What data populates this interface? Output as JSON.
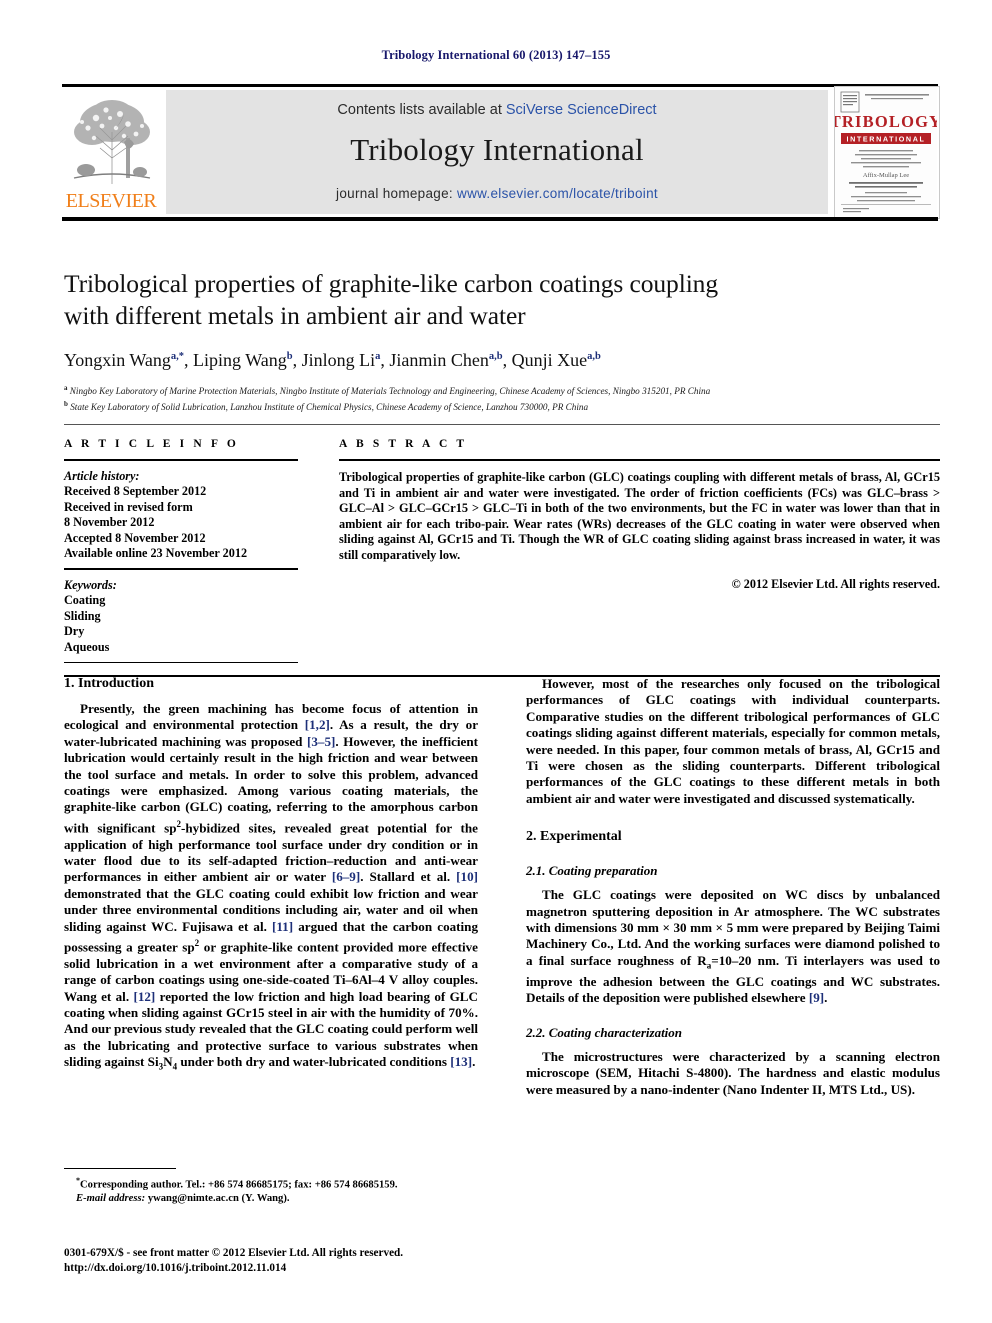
{
  "running_head": "Tribology International 60 (2013) 147–155",
  "masthead": {
    "contents_prefix": "Contents lists available at ",
    "contents_link": "SciVerse ScienceDirect",
    "journal_title": "Tribology International",
    "homepage_prefix": "journal homepage: ",
    "homepage_url": "www.elsevier.com/locate/triboint",
    "publisher_wordmark": "ELSEVIER",
    "cover_title_main": "TRIBOLOGY",
    "cover_title_sub": "INTERNATIONAL"
  },
  "article": {
    "title_line1": "Tribological properties of graphite-like carbon coatings coupling",
    "title_line2": "with different metals in ambient air and water",
    "authors": [
      {
        "name": "Yongxin Wang",
        "sup": "a,*"
      },
      {
        "name": "Liping Wang",
        "sup": "b"
      },
      {
        "name": "Jinlong Li",
        "sup": "a"
      },
      {
        "name": "Jianmin Chen",
        "sup": "a,b"
      },
      {
        "name": "Qunji Xue",
        "sup": "a,b"
      }
    ],
    "affiliations": [
      {
        "marker": "a",
        "text": "Ningbo Key Laboratory of Marine Protection Materials, Ningbo Institute of Materials Technology and Engineering, Chinese Academy of Sciences, Ningbo 315201, PR China"
      },
      {
        "marker": "b",
        "text": "State Key Laboratory of Solid Lubrication, Lanzhou Institute of Chemical Physics, Chinese Academy of Science, Lanzhou 730000, PR China"
      }
    ]
  },
  "article_info": {
    "label": "A R T I C L E   I N F O",
    "history_label": "Article history:",
    "history": [
      "Received 8 September 2012",
      "Received in revised form",
      "8 November 2012",
      "Accepted 8 November 2012",
      "Available online 23 November 2012"
    ],
    "keywords_label": "Keywords:",
    "keywords": [
      "Coating",
      "Sliding",
      "Dry",
      "Aqueous"
    ]
  },
  "abstract": {
    "label": "A B S T R A C T",
    "text": "Tribological properties of graphite-like carbon (GLC) coatings coupling with different metals of brass, Al, GCr15 and Ti in ambient air and water were investigated. The order of friction coefficients (FCs) was GLC–brass > GLC–Al > GLC–GCr15 > GLC–Ti in both of the two environments, but the FC in water was lower than that in ambient air for each tribo-pair. Wear rates (WRs) decreases of the GLC coating in water were observed when sliding against Al, GCr15 and Ti. Though the WR of GLC coating sliding against brass increased in water, it was still comparatively low.",
    "copyright": "© 2012 Elsevier Ltd. All rights reserved."
  },
  "sections": {
    "introduction_heading": "1.  Introduction",
    "intro_p1_a": "Presently, the green machining has become focus of attention in ecological and environmental protection ",
    "intro_ref1": "[1,2]",
    "intro_p1_b": ". As a result, the dry or water-lubricated machining was proposed ",
    "intro_ref2": "[3–5]",
    "intro_p1_c": ". However, the inefficient lubrication would certainly result in the high friction and wear between the tool surface and metals. In order to solve this problem, advanced coatings were emphasized. Among various coating materials, the graphite-like carbon (GLC) coating, referring to the amorphous carbon with significant sp",
    "intro_p1_d": "-hybidized sites, revealed great potential for the application of high performance tool surface under dry condition or in water flood due to its self-adapted friction–reduction and anti-wear performances in either ambient air or water ",
    "intro_ref3": "[6–9]",
    "intro_p1_e": ". Stallard et al. ",
    "intro_ref4": "[10]",
    "intro_p1_f": " demonstrated that the GLC coating could exhibit low friction and wear under three environmental conditions including air, water and oil when sliding against WC. Fujisawa et al. ",
    "intro_ref5": "[11]",
    "intro_p1_g": " argued that the carbon coating possessing a greater sp",
    "intro_p1_h": " or graphite-like content provided more effective solid lubrication in a wet environment after a comparative study of a range of carbon coatings using one-side-coated Ti–6Al–4 V alloy couples. Wang et al. ",
    "intro_ref6": "[12]",
    "intro_p1_i": " reported the low friction and high load bearing of GLC coating when sliding against GCr15 steel in air with the humidity of 70%. And our previous study revealed that the GLC coating could perform well as the lubricating and protective surface to various substrates when sliding against Si",
    "intro_p1_j": "N",
    "intro_p1_k": " under both dry and water-lubricated conditions ",
    "intro_ref7": "[13]",
    "intro_p1_l": ".",
    "right_p1": "However, most of the researches only focused on the tribological performances of GLC coatings with individual counterparts. Comparative studies on the different tribological performances of GLC coatings sliding against different materials, especially for common metals, were needed. In this paper, four common metals of brass, Al, GCr15 and Ti were chosen as the sliding counterparts. Different tribological performances of the GLC coatings to these different metals in both ambient air and water were investigated and discussed systematically.",
    "experimental_heading": "2.  Experimental",
    "sub21_heading": "2.1.  Coating preparation",
    "sub21_a": "The GLC coatings were deposited on WC discs by unbalanced magnetron sputtering deposition in Ar atmosphere. The WC substrates with dimensions 30 mm × 30 mm × 5 mm were prepared by Beijing Taimi Machinery Co., Ltd. And the working surfaces were diamond polished to a final surface roughness of R",
    "sub21_b": "=10–20 nm. Ti interlayers was used to improve the adhesion between the GLC coatings and WC substrates. Details of the deposition were published elsewhere ",
    "sub21_ref": "[9]",
    "sub21_c": ".",
    "sub22_heading": "2.2.  Coating characterization",
    "sub22_text": "The microstructures were characterized by a scanning electron microscope (SEM, Hitachi S-4800). The hardness and elastic modulus were measured by a nano-indenter (Nano Indenter II, MTS Ltd., US)."
  },
  "footnotes": {
    "corresponding_marker": "*",
    "corresponding_text": "Corresponding author. Tel.: +86 574 86685175; fax: +86 574 86685159.",
    "email_label": "E-mail address:",
    "email_value": "ywang@nimte.ac.cn (Y. Wang)."
  },
  "imprint": {
    "line1": "0301-679X/$ - see front matter © 2012 Elsevier Ltd. All rights reserved.",
    "line2": "http://dx.doi.org/10.1016/j.triboint.2012.11.014"
  },
  "superscripts": {
    "sp2": "2",
    "sub3": "3",
    "sub4": "4",
    "ra_sub": "a"
  },
  "colors": {
    "link_blue": "#2b53a8",
    "ref_blue": "#1d2f78",
    "elsevier_orange": "#f07f1a",
    "masthead_gray": "#e3e3e3",
    "cover_red": "#b42025"
  }
}
